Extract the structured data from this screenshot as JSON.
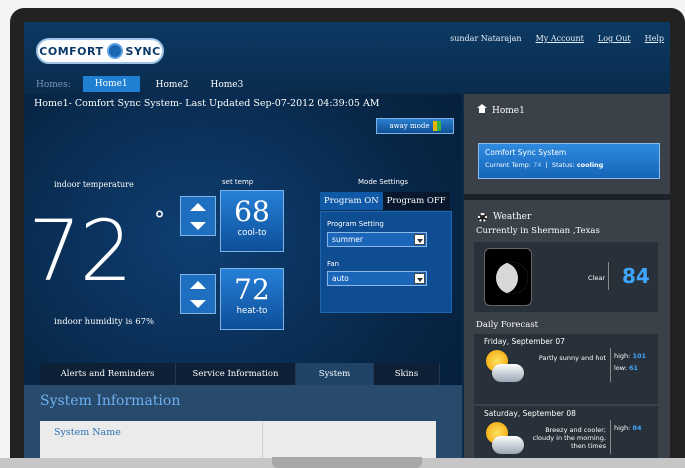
{
  "header": {
    "brand_left": "COMFORT",
    "brand_right": "SYNC",
    "user_name": "sundar Natarajan",
    "links": [
      "My Account",
      "Log Out",
      "Help"
    ]
  },
  "home_tabs": {
    "label": "Homes:",
    "tabs": [
      "Home1",
      "Home2",
      "Home3"
    ],
    "active": "Home1"
  },
  "status_line": "Home1- Comfort Sync System- Last Updated Sep-07-2012 04:39:05 AM",
  "away_mode_label": "away mode",
  "indoor": {
    "label": "indoor temperature",
    "temperature": "72",
    "degree": "°",
    "humidity_text": "indoor humidity is 67%"
  },
  "set_temp": {
    "label": "set temp",
    "cool": {
      "value": "68",
      "mode": "cool-to"
    },
    "heat": {
      "value": "72",
      "mode": "heat-to"
    }
  },
  "mode_settings": {
    "label": "Mode Settings",
    "program_on": "Program ON",
    "program_off": "Program OFF",
    "program_setting_label": "Program Setting",
    "program_setting_value": "summer",
    "fan_label": "Fan",
    "fan_value": "auto"
  },
  "bottom_tabs": [
    "Alerts and Reminders",
    "Service Information",
    "System",
    "Skins"
  ],
  "bottom_active": "System",
  "system_info": {
    "title": "System Information",
    "system_name_label": "System Name"
  },
  "right": {
    "home_title": "Home1",
    "system_button": {
      "name": "Comfort Sync System",
      "current_temp_label": "Current Temp:",
      "current_temp_value": "74",
      "status_label": "Status:",
      "status_value": "cooling"
    },
    "weather": {
      "title": "Weather",
      "location": "Currently in Sherman ,Texas",
      "condition": "Clear",
      "temperature": "84",
      "daily_label": "Daily Forecast",
      "forecast": [
        {
          "day": "Friday, September 07",
          "desc": "Partly sunny and hot",
          "high_label": "high:",
          "high": "101",
          "low_label": "low:",
          "low": "61"
        },
        {
          "day": "Saturday, September 08",
          "desc": "Breezy and cooler; cloudy in the morning, then times",
          "high_label": "high:",
          "high": "84",
          "low_label": "",
          "low": ""
        }
      ]
    }
  },
  "colors": {
    "accent_blue": "#1f7fd2",
    "temp_blue": "#3fa6ff",
    "panel_dark": "#3a4148"
  }
}
